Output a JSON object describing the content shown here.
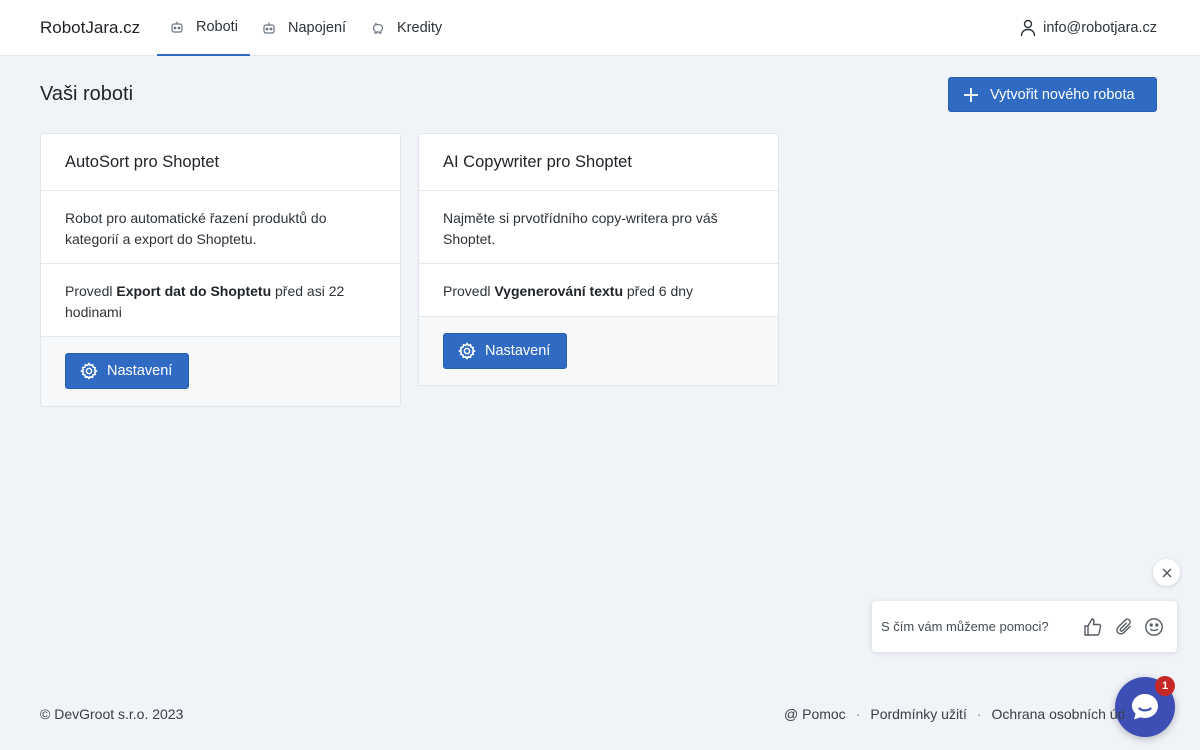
{
  "header": {
    "brand": "RobotJara.cz",
    "nav": [
      {
        "label": "Roboti",
        "icon": "robot-icon",
        "active": true
      },
      {
        "label": "Napojení",
        "icon": "robot-icon",
        "active": false
      },
      {
        "label": "Kredity",
        "icon": "piggy-bank-icon",
        "active": false
      }
    ],
    "user_email": "info@robotjara.cz",
    "user_icon": "user-icon"
  },
  "main": {
    "title": "Vaši roboti",
    "create_button": "Vytvořit nového robota"
  },
  "cards": [
    {
      "title": "AutoSort pro Shoptet",
      "description": "Robot pro automatické řazení produktů do kategorií a export do Shoptetu.",
      "activity_prefix": "Provedl ",
      "activity_action": "Export dat do Shoptetu",
      "activity_suffix": " před asi 22 hodinami",
      "settings_label": "Nastavení"
    },
    {
      "title": "AI Copywriter pro Shoptet",
      "description": "Najměte si prvotřídního copy-writera pro váš Shoptet.",
      "activity_prefix": "Provedl ",
      "activity_action": "Vygenerování textu",
      "activity_suffix": " před 6 dny",
      "settings_label": "Nastavení"
    }
  ],
  "chat": {
    "placeholder": "S čím vám můžeme pomoci?",
    "badge_count": "1",
    "icons": [
      "close-icon",
      "thumbs-up-icon",
      "paperclip-icon",
      "emoji-icon",
      "chat-bubble-icon"
    ]
  },
  "footer": {
    "copyright": "© DevGroot s.r.o. 2023",
    "links": [
      "@ Pomoc",
      "Pordmínky užití",
      "Ochrana osobních údajů"
    ],
    "separator": "·"
  },
  "colors": {
    "accent": "#2f6bc2",
    "background": "#f0f3f8",
    "chat_launcher": "#3d4fb5",
    "badge": "#c62828"
  }
}
